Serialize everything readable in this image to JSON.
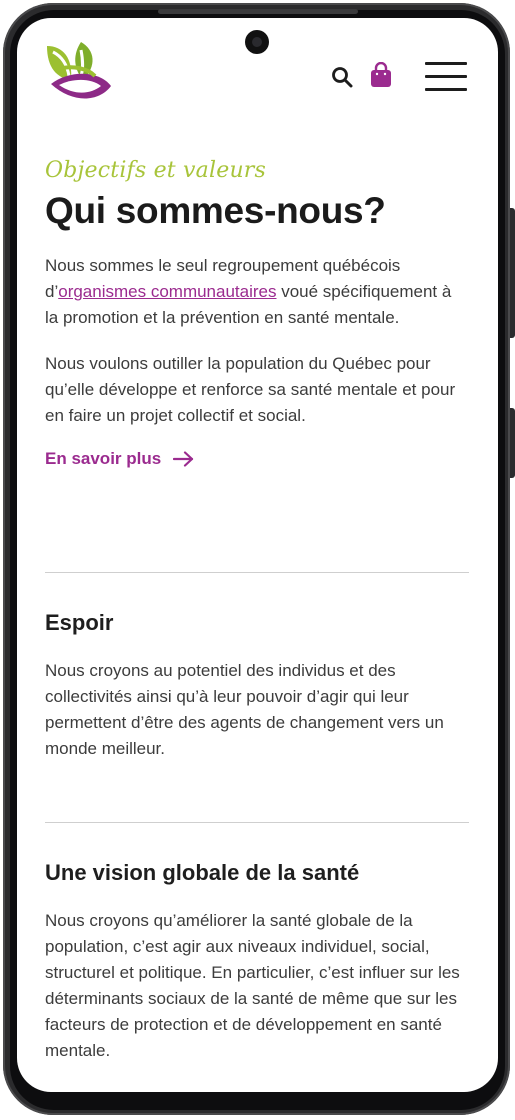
{
  "header": {
    "logo_alt": "logo",
    "search_icon": "search-icon",
    "bag_icon": "shopping-bag-icon",
    "menu_icon": "hamburger-menu-icon"
  },
  "intro": {
    "eyebrow": "Objectifs et valeurs",
    "title": "Qui sommes-nous?",
    "para1_before": "Nous sommes le seul regroupement québécois d’",
    "para1_link": "organismes communautaires",
    "para1_after": " voué spécifiquement à la promotion et la prévention en santé mentale.",
    "para2": "Nous voulons outiller la population du Québec pour qu’elle développe et renforce sa santé mentale et pour en faire un projet collectif et social.",
    "more_label": "En savoir plus"
  },
  "sections": [
    {
      "heading": "Espoir",
      "body": "Nous croyons au potentiel des individus et des collectivités ainsi qu’à leur pouvoir d’agir qui leur permettent d’être des agents de changement vers un monde meilleur."
    },
    {
      "heading": "Une vision globale de la santé",
      "body": "Nous croyons qu’améliorer la santé globale de la population, c’est agir aux niveaux individuel, social, structurel et politique. En particulier, c’est influer sur les déterminants sociaux de la santé de même que sur les facteurs de protection et de développement en santé mentale."
    }
  ],
  "colors": {
    "accent_green": "#a8c43a",
    "accent_purple": "#9b2b8f",
    "text": "#3c3c3c",
    "heading": "#1b1b1b"
  }
}
